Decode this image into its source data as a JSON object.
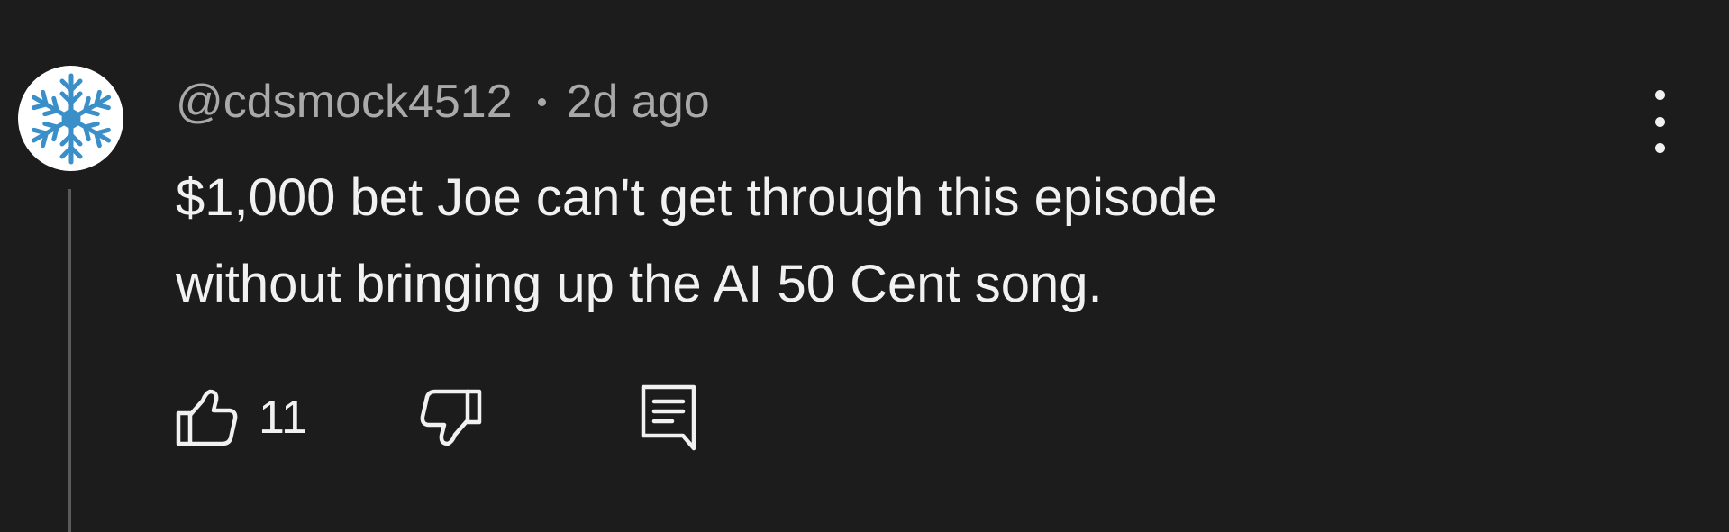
{
  "comment": {
    "avatar_icon": "snowflake-icon",
    "avatar_color": "#3a8fc9",
    "username": "@cdsmock4512",
    "timestamp": "2d ago",
    "text": "$1,000 bet Joe can't get through this episode\nwithout bringing up the AI 50 Cent song.",
    "like_count": "11",
    "icons": {
      "like": "thumbs-up-icon",
      "dislike": "thumbs-down-icon",
      "reply": "reply-icon",
      "more": "more-vertical-icon"
    }
  }
}
